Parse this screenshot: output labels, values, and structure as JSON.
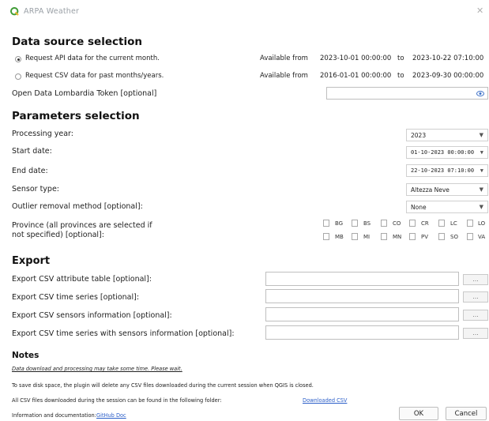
{
  "window": {
    "title": "ARPA Weather",
    "close_glyph": "✕"
  },
  "data_source": {
    "heading": "Data source selection",
    "api_option": {
      "label": "Request API data for the current month.",
      "available_label": "Available from",
      "from": "2023-10-01 00:00:00",
      "to_word": "to",
      "to": "2023-10-22 07:10:00",
      "selected": true
    },
    "csv_option": {
      "label": "Request CSV data for past months/years.",
      "available_label": "Available from",
      "from": "2016-01-01 00:00:00",
      "to_word": "to",
      "to": "2023-09-30 00:00:00",
      "selected": false
    },
    "token_label": "Open Data Lombardia Token [optional]",
    "token_value": ""
  },
  "parameters": {
    "heading": "Parameters selection",
    "processing_year": {
      "label": "Processing year:",
      "value": "2023"
    },
    "start_date": {
      "label": "Start date:",
      "value": "01-10-2023 00:00:00"
    },
    "end_date": {
      "label": "End date:",
      "value": "22-10-2023 07:10:00"
    },
    "sensor_type": {
      "label": "Sensor type:",
      "value": "Altezza Neve"
    },
    "outlier": {
      "label": "Outlier removal method [optional]:",
      "value": "None"
    },
    "province": {
      "label_line1": "Province (all provinces are selected if",
      "label_line2": "not specified) [optional]:",
      "row1": [
        "BG",
        "BS",
        "CO",
        "CR",
        "LC",
        "LO"
      ],
      "row2": [
        "MB",
        "MI",
        "MN",
        "PV",
        "SO",
        "VA"
      ]
    }
  },
  "export": {
    "heading": "Export",
    "rows": [
      {
        "label": "Export CSV attribute table [optional]:",
        "value": "",
        "browse": "..."
      },
      {
        "label": "Export CSV time series [optional]:",
        "value": "",
        "browse": "..."
      },
      {
        "label": "Export CSV sensors information [optional]:",
        "value": "",
        "browse": "..."
      },
      {
        "label": "Export CSV time series with sensors information [optional]:",
        "value": "",
        "browse": "..."
      }
    ]
  },
  "notes": {
    "heading": "Notes",
    "line1": "Data download and processing may take some time. Please wait.",
    "line2": "To save disk space, the plugin will delete any CSV files downloaded during the current session when QGIS is closed.",
    "line3": "All CSV files downloaded during the session can be found in the following folder:",
    "line3_link": "Downloaded CSV",
    "line4": "Information and documentation:",
    "line4_link": "GitHub Doc"
  },
  "buttons": {
    "ok": "OK",
    "cancel": "Cancel"
  },
  "colors": {
    "link": "#2c5fc9",
    "logo": "#3f9c35"
  }
}
